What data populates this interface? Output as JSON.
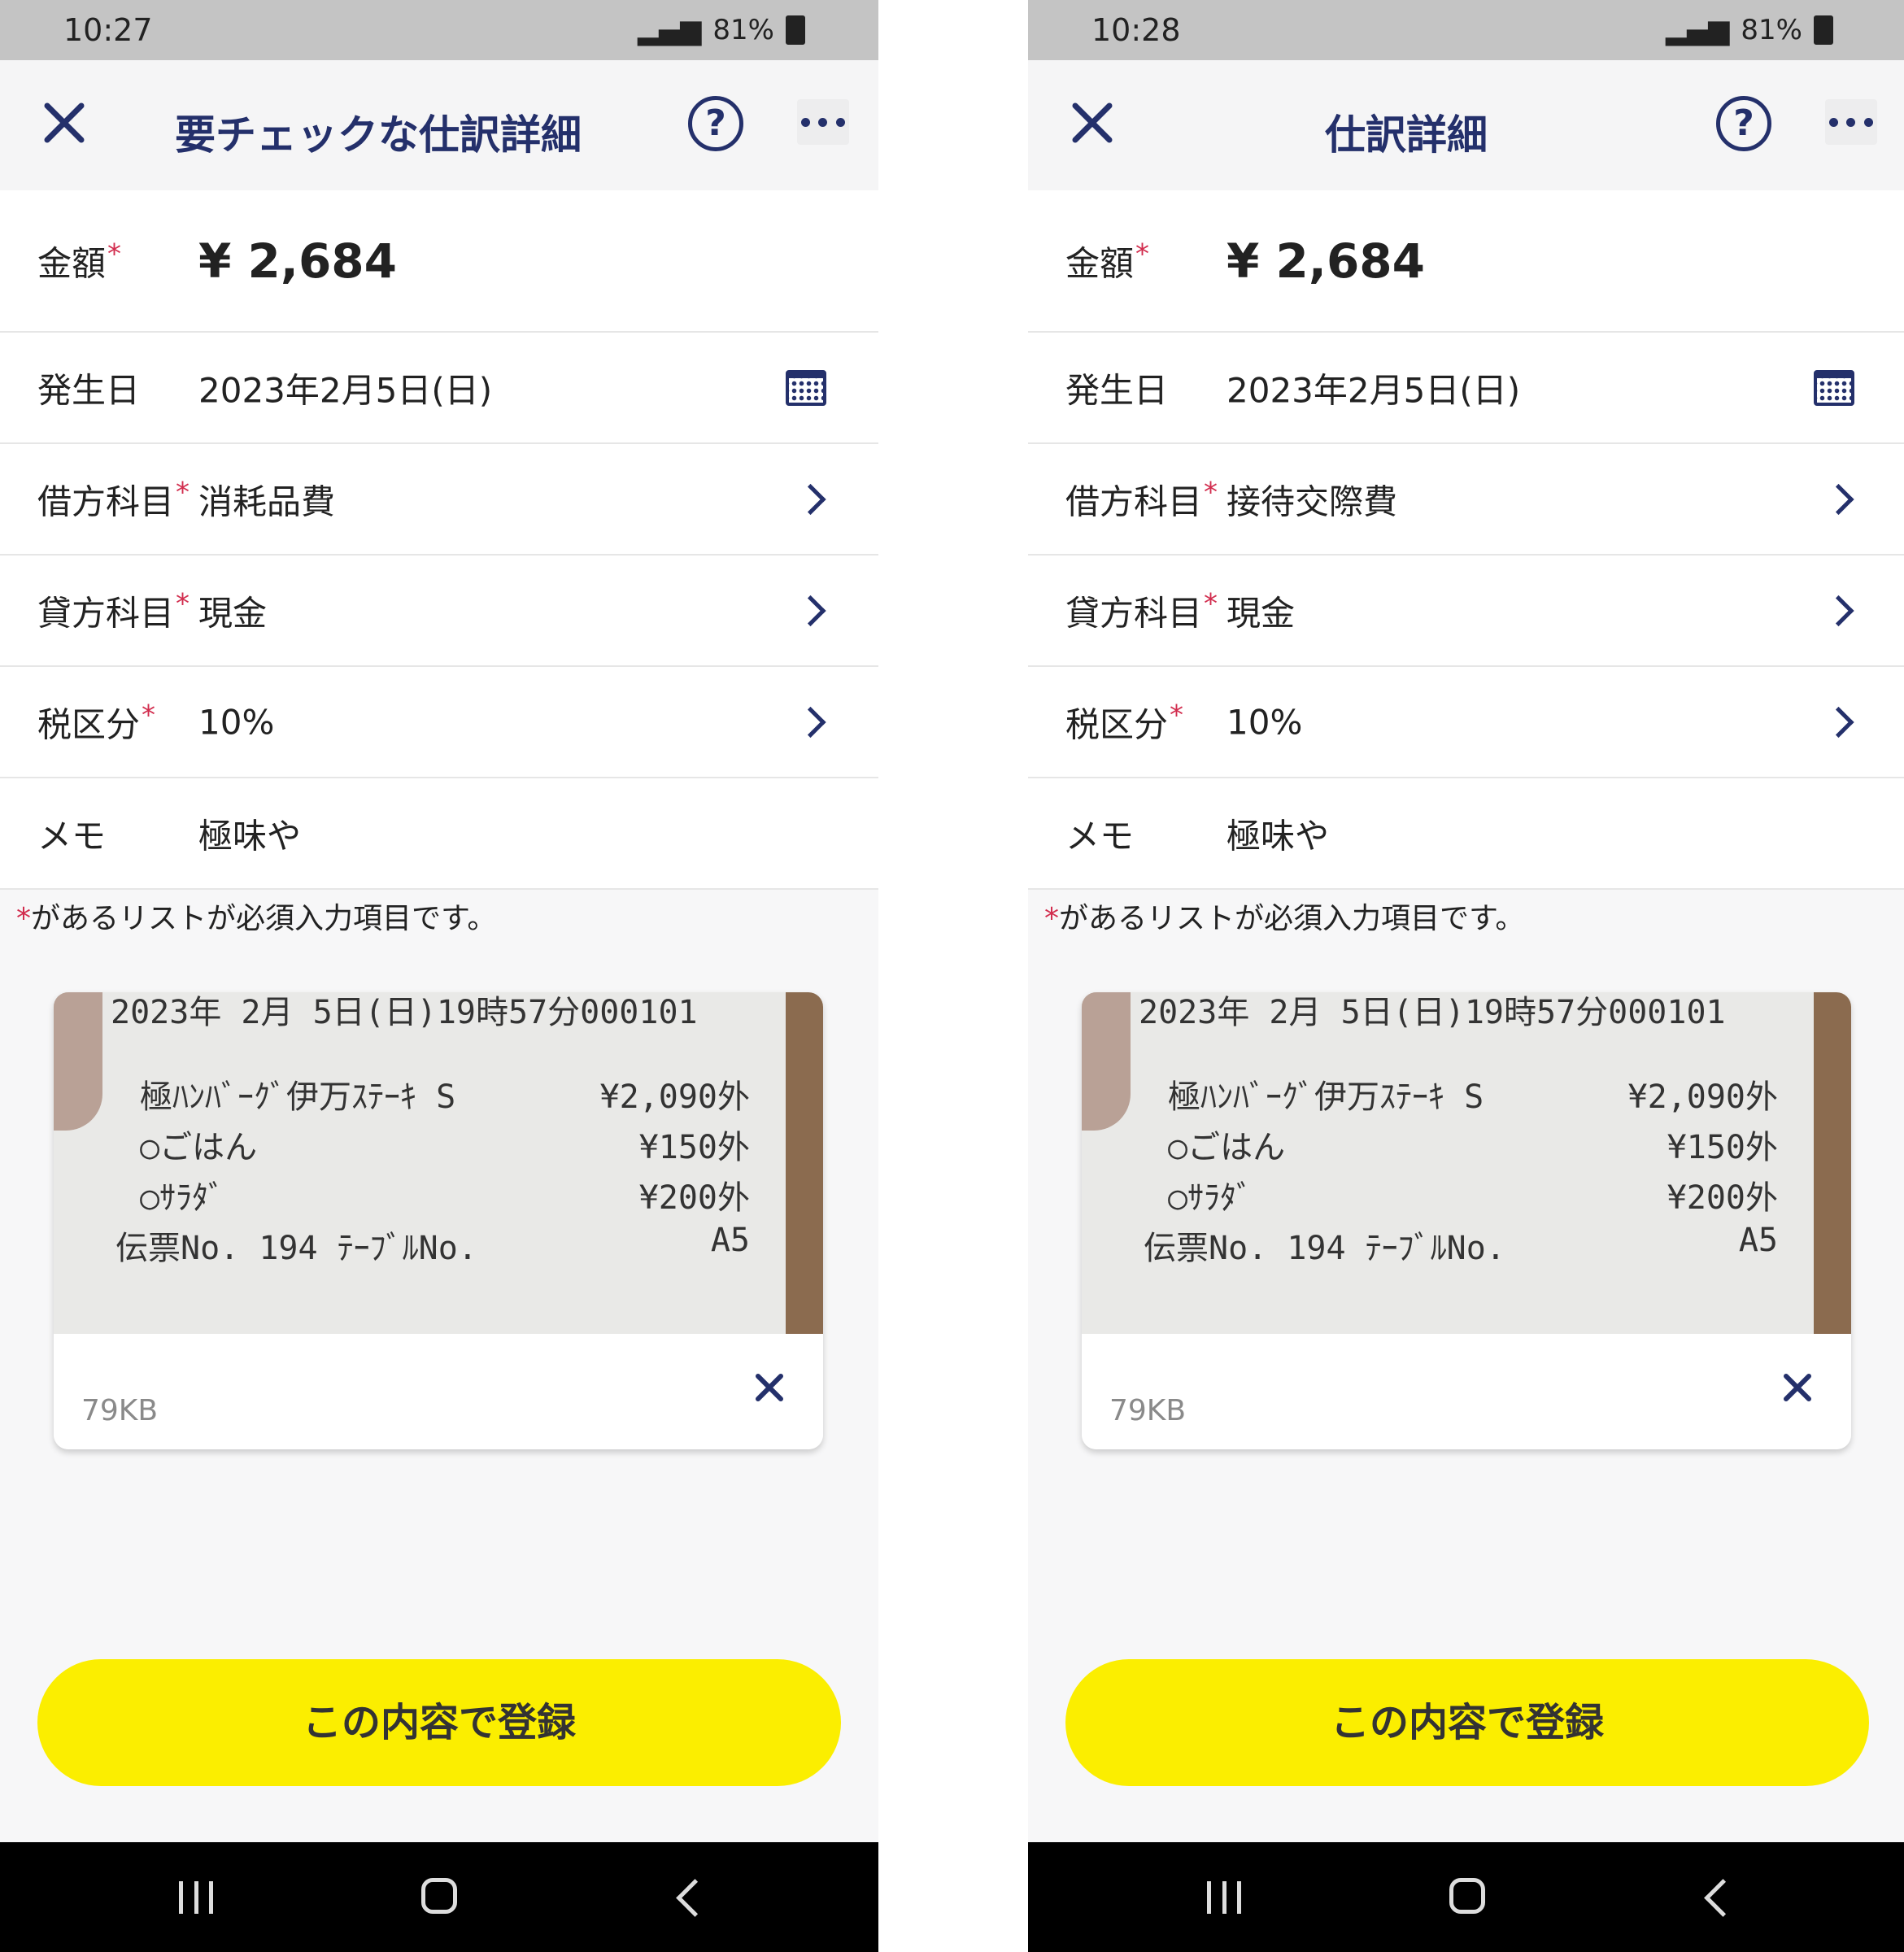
{
  "screens": [
    {
      "status": {
        "time": "10:27",
        "battery": "81%"
      },
      "header": {
        "title": "要チェックな仕訳詳細",
        "help": "?"
      },
      "form": {
        "amount": {
          "label": "金額",
          "required": "*",
          "value": "¥ 2,684"
        },
        "date": {
          "label": "発生日",
          "value": "2023年2月5日(日)"
        },
        "debit": {
          "label": "借方科目",
          "required": "*",
          "value": "消耗品費"
        },
        "credit": {
          "label": "貸方科目",
          "required": "*",
          "value": "現金"
        },
        "tax": {
          "label": "税区分",
          "required": "*",
          "value": "10%"
        },
        "memo": {
          "label": "メモ",
          "value": "極味や"
        }
      },
      "note": {
        "mark": "*",
        "text": "があるリストが必須入力項目です。"
      },
      "attachment": {
        "size": "79KB",
        "receipt_lines": [
          {
            "left": "2023年 2月 5日(日)19時57分000101",
            "right": ""
          },
          {
            "left": "極ﾊﾝﾊﾞｰｸﾞ伊万ｽﾃｰｷ S",
            "right": "¥2,090外"
          },
          {
            "left": "○ごはん",
            "right": "¥150外"
          },
          {
            "left": "○ｻﾗﾀﾞ",
            "right": "¥200外"
          },
          {
            "left": "伝票No.    194   ﾃｰﾌﾞﾙNo.",
            "right": "A5"
          }
        ]
      },
      "register_button": "この内容で登録"
    },
    {
      "status": {
        "time": "10:28",
        "battery": "81%"
      },
      "header": {
        "title": "仕訳詳細",
        "help": "?"
      },
      "form": {
        "amount": {
          "label": "金額",
          "required": "*",
          "value": "¥ 2,684"
        },
        "date": {
          "label": "発生日",
          "value": "2023年2月5日(日)"
        },
        "debit": {
          "label": "借方科目",
          "required": "*",
          "value": "接待交際費"
        },
        "credit": {
          "label": "貸方科目",
          "required": "*",
          "value": "現金"
        },
        "tax": {
          "label": "税区分",
          "required": "*",
          "value": "10%"
        },
        "memo": {
          "label": "メモ",
          "value": "極味や"
        }
      },
      "note": {
        "mark": "*",
        "text": "があるリストが必須入力項目です。"
      },
      "attachment": {
        "size": "79KB",
        "receipt_lines": [
          {
            "left": "2023年 2月 5日(日)19時57分000101",
            "right": ""
          },
          {
            "left": "極ﾊﾝﾊﾞｰｸﾞ伊万ｽﾃｰｷ S",
            "right": "¥2,090外"
          },
          {
            "left": "○ごはん",
            "right": "¥150外"
          },
          {
            "left": "○ｻﾗﾀﾞ",
            "right": "¥200外"
          },
          {
            "left": "伝票No.    194   ﾃｰﾌﾞﾙNo.",
            "right": "A5"
          }
        ]
      },
      "register_button": "この内容で登録"
    }
  ],
  "colors": {
    "accent": "#24306b",
    "required": "#d22d4e",
    "button": "#fbee00"
  },
  "icons": [
    "close-icon",
    "help-icon",
    "more-icon",
    "calendar-icon",
    "chevron-right-icon",
    "remove-icon"
  ]
}
